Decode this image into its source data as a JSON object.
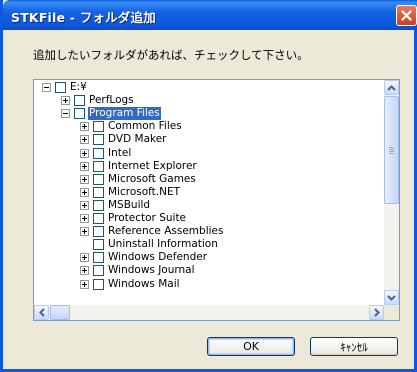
{
  "window": {
    "title": "STKFile - フォルダ追加",
    "close_icon": "close-icon"
  },
  "instruction": "追加したいフォルダがあれば、チェックして下さい。",
  "tree": {
    "items": [
      {
        "label": "E:¥",
        "level": 0,
        "expander": "minus",
        "checked": false,
        "selected": false
      },
      {
        "label": "PerfLogs",
        "level": 1,
        "expander": "plus",
        "checked": false,
        "selected": false
      },
      {
        "label": "Program Files",
        "level": 1,
        "expander": "minus",
        "checked": false,
        "selected": true
      },
      {
        "label": "Common Files",
        "level": 2,
        "expander": "plus",
        "checked": false,
        "selected": false
      },
      {
        "label": "DVD Maker",
        "level": 2,
        "expander": "plus",
        "checked": false,
        "selected": false
      },
      {
        "label": "Intel",
        "level": 2,
        "expander": "plus",
        "checked": false,
        "selected": false
      },
      {
        "label": "Internet Explorer",
        "level": 2,
        "expander": "plus",
        "checked": false,
        "selected": false
      },
      {
        "label": "Microsoft Games",
        "level": 2,
        "expander": "plus",
        "checked": false,
        "selected": false
      },
      {
        "label": "Microsoft.NET",
        "level": 2,
        "expander": "plus",
        "checked": false,
        "selected": false
      },
      {
        "label": "MSBuild",
        "level": 2,
        "expander": "plus",
        "checked": false,
        "selected": false
      },
      {
        "label": "Protector Suite",
        "level": 2,
        "expander": "plus",
        "checked": false,
        "selected": false
      },
      {
        "label": "Reference Assemblies",
        "level": 2,
        "expander": "plus",
        "checked": false,
        "selected": false
      },
      {
        "label": "Uninstall Information",
        "level": 2,
        "expander": "none",
        "checked": false,
        "selected": false
      },
      {
        "label": "Windows Defender",
        "level": 2,
        "expander": "plus",
        "checked": false,
        "selected": false
      },
      {
        "label": "Windows Journal",
        "level": 2,
        "expander": "plus",
        "checked": false,
        "selected": false
      },
      {
        "label": "Windows Mail",
        "level": 2,
        "expander": "plus",
        "checked": false,
        "selected": false
      }
    ]
  },
  "scroll": {
    "vertical_position": 0,
    "horizontal_position": 0
  },
  "buttons": {
    "ok": "OK",
    "cancel": "ｷｬﾝｾﾙ"
  },
  "colors": {
    "titlebar": "#0a5fd8",
    "selection": "#316ac5",
    "dialog_face": "#ece9d8"
  }
}
